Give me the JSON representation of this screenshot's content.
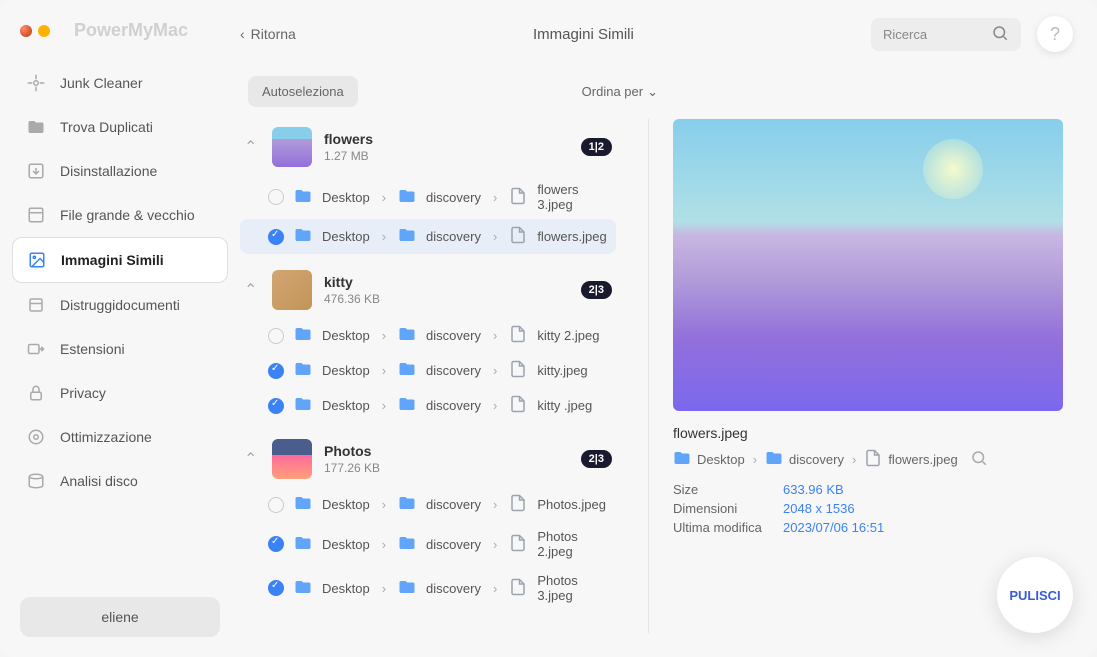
{
  "app_title": "PowerMyMac",
  "back_label": "Ritorna",
  "page_title": "Immagini Simili",
  "search_placeholder": "Ricerca",
  "help_label": "?",
  "autoselect_label": "Autoseleziona",
  "sort_label": "Ordina per",
  "user_name": "eliene",
  "clean_label": "PULISCI",
  "nav": [
    {
      "label": "Junk Cleaner"
    },
    {
      "label": "Trova Duplicati"
    },
    {
      "label": "Disinstallazione"
    },
    {
      "label": "File grande & vecchio"
    },
    {
      "label": "Immagini Simili"
    },
    {
      "label": "Distruggidocumenti"
    },
    {
      "label": "Estensioni"
    },
    {
      "label": "Privacy"
    },
    {
      "label": "Ottimizzazione"
    },
    {
      "label": "Analisi disco"
    }
  ],
  "groups": [
    {
      "name": "flowers",
      "size": "1.27 MB",
      "badge": "1|2",
      "files": [
        {
          "checked": false,
          "p1": "Desktop",
          "p2": "discovery",
          "name": "flowers 3.jpeg",
          "selected": false
        },
        {
          "checked": true,
          "p1": "Desktop",
          "p2": "discovery",
          "name": "flowers.jpeg",
          "selected": true
        }
      ]
    },
    {
      "name": "kitty",
      "size": "476.36 KB",
      "badge": "2|3",
      "files": [
        {
          "checked": false,
          "p1": "Desktop",
          "p2": "discovery",
          "name": "kitty 2.jpeg"
        },
        {
          "checked": true,
          "p1": "Desktop",
          "p2": "discovery",
          "name": "kitty.jpeg"
        },
        {
          "checked": true,
          "p1": "Desktop",
          "p2": "discovery",
          "name": "kitty .jpeg"
        }
      ]
    },
    {
      "name": "Photos",
      "size": "177.26 KB",
      "badge": "2|3",
      "files": [
        {
          "checked": false,
          "p1": "Desktop",
          "p2": "discovery",
          "name": "Photos.jpeg"
        },
        {
          "checked": true,
          "p1": "Desktop",
          "p2": "discovery",
          "name": "Photos 2.jpeg"
        },
        {
          "checked": true,
          "p1": "Desktop",
          "p2": "discovery",
          "name": "Photos 3.jpeg"
        }
      ]
    }
  ],
  "preview": {
    "name": "flowers.jpeg",
    "path": {
      "p1": "Desktop",
      "p2": "discovery",
      "file": "flowers.jpeg"
    },
    "meta": {
      "size_label": "Size",
      "size_val": "633.96 KB",
      "dim_label": "Dimensioni",
      "dim_val": "2048 x 1536",
      "mod_label": "Ultima modifica",
      "mod_val": "2023/07/06 16:51"
    }
  }
}
